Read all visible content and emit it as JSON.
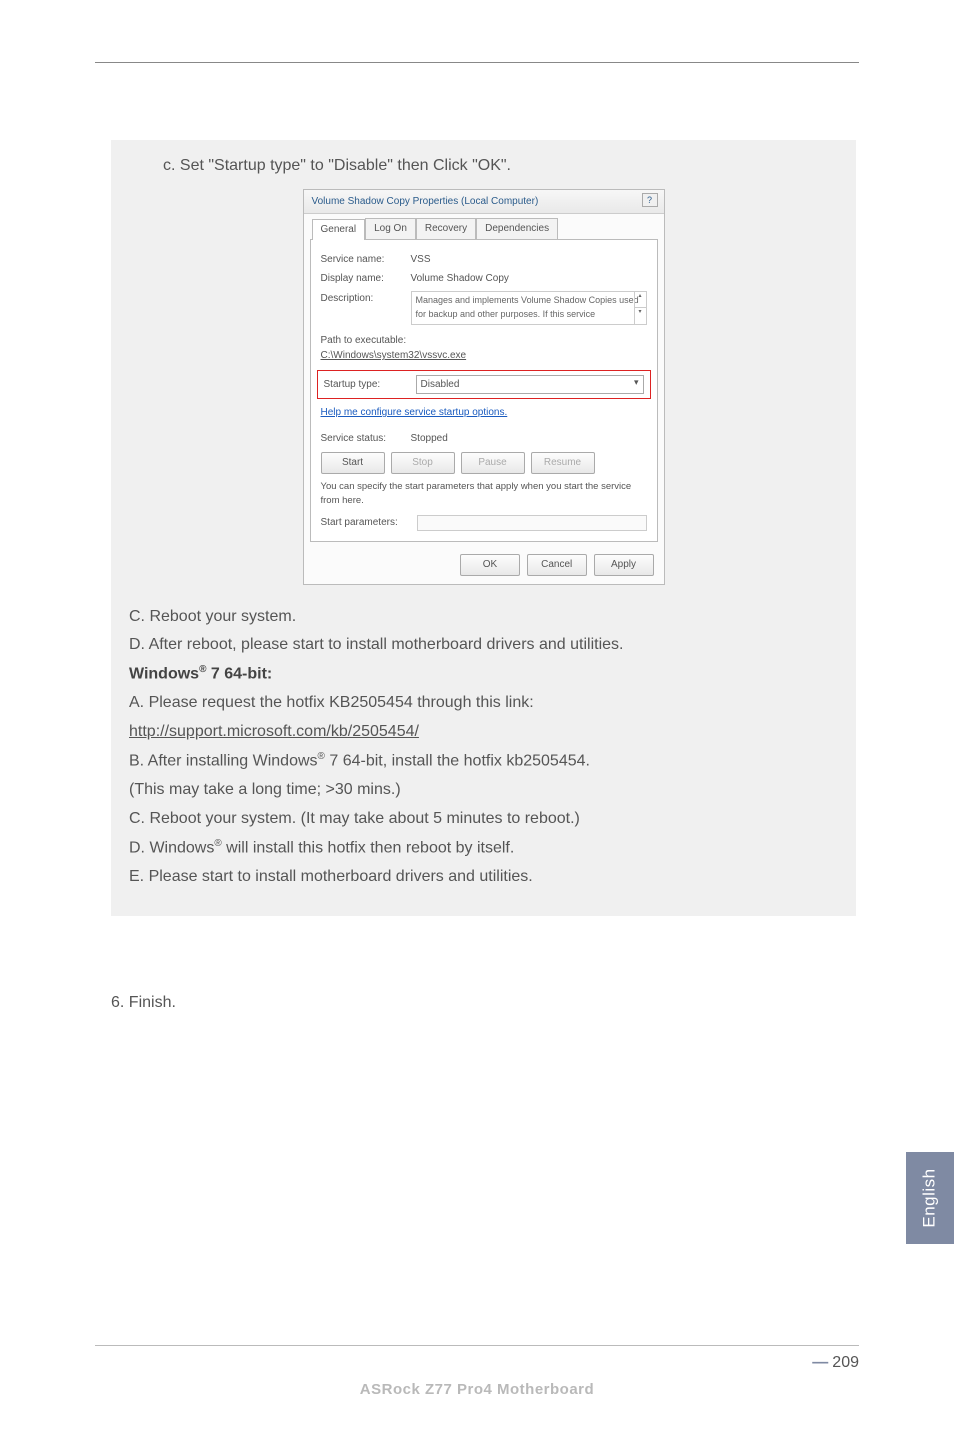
{
  "instruction": {
    "step_c": "c. Set \"Startup type\" to \"Disable\" then Click \"OK\"."
  },
  "dialog": {
    "title": "Volume Shadow Copy Properties (Local Computer)",
    "help_btn": "?",
    "tabs": {
      "general": "General",
      "logon": "Log On",
      "recovery": "Recovery",
      "dependencies": "Dependencies"
    },
    "service_name_label": "Service name:",
    "service_name_value": "VSS",
    "display_name_label": "Display name:",
    "display_name_value": "Volume Shadow Copy",
    "description_label": "Description:",
    "description_value": "Manages and implements Volume Shadow Copies used for backup and other purposes. If this service",
    "path_label": "Path to executable:",
    "path_value": "C:\\Windows\\system32\\vssvc.exe",
    "startup_label": "Startup type:",
    "startup_value": "Disabled",
    "help_link": "Help me configure service startup options.",
    "status_label": "Service status:",
    "status_value": "Stopped",
    "btn_start": "Start",
    "btn_stop": "Stop",
    "btn_pause": "Pause",
    "btn_resume": "Resume",
    "hint": "You can specify the start parameters that apply when you start the service from here.",
    "params_label": "Start parameters:",
    "ok": "OK",
    "cancel": "Cancel",
    "apply": "Apply"
  },
  "section1": {
    "c": "C. Reboot your system.",
    "d": "D. After reboot, please start to install motherboard drivers and utilities."
  },
  "win7": {
    "header_prefix": "Windows",
    "header_suffix": " 7 64-bit:",
    "a": "A. Please request the hotfix KB2505454 through this link:",
    "a_link": "http://support.microsoft.com/kb/2505454/",
    "b_prefix": "B. After installing Windows",
    "b_suffix": " 7 64-bit, install the hotfix kb2505454.",
    "b_note": "(This may take a long time; >30 mins.)",
    "c": "C. Reboot your system. (It may take about 5 minutes to reboot.)",
    "d_prefix": "D. Windows",
    "d_suffix": " will install this hotfix then reboot by itself.",
    "e": "E. Please start to install motherboard drivers and utilities."
  },
  "finish": "6. Finish.",
  "side_tab": "English",
  "page_number": "209",
  "footer": "ASRock  Z77  Pro4  Motherboard",
  "reg_mark": "®"
}
